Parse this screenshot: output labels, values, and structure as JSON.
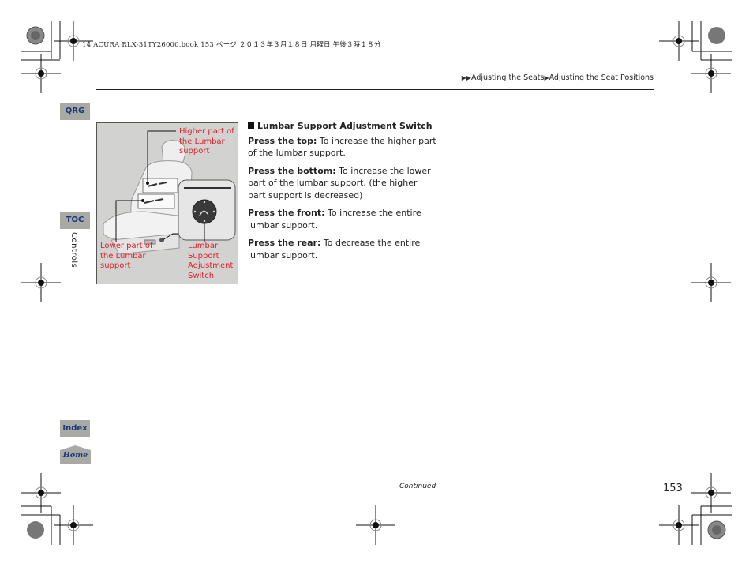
{
  "print_header": "14 ACURA RLX-31TY26000.book  153 ページ  ２０１３年３月１８日  月曜日  午後３時１８分",
  "breadcrumb": {
    "prefix_icon": "double-arrow-icon",
    "items": [
      "Adjusting the Seats",
      "Adjusting the Seat Positions"
    ],
    "separator_icon": "arrow-right-icon"
  },
  "side_tabs": {
    "qrg": "QRG",
    "toc": "TOC",
    "index": "Index",
    "home": "Home",
    "section": "Controls"
  },
  "figure": {
    "callouts": {
      "higher": "Higher part of the Lumbar support",
      "lower": "Lower part of the Lumbar support",
      "switch": "Lumbar Support Adjustment Switch"
    },
    "callout_color": "#e0202a"
  },
  "content": {
    "heading": "Lumbar Support Adjustment Switch",
    "items": [
      {
        "label": "Press the top:",
        "text": " To increase the higher part of the lumbar support."
      },
      {
        "label": "Press the bottom:",
        "text": " To increase the lower part of the lumbar support. (the higher part support is decreased)"
      },
      {
        "label": "Press the front:",
        "text": " To increase the entire lumbar support."
      },
      {
        "label": "Press the rear:",
        "text": " To decrease the entire lumbar support."
      }
    ]
  },
  "footer": {
    "continued": "Continued",
    "page_number": "153"
  },
  "colors": {
    "tab_bg": "#a9aaa6",
    "tab_text": "#1c3a78",
    "callout": "#e0202a"
  }
}
